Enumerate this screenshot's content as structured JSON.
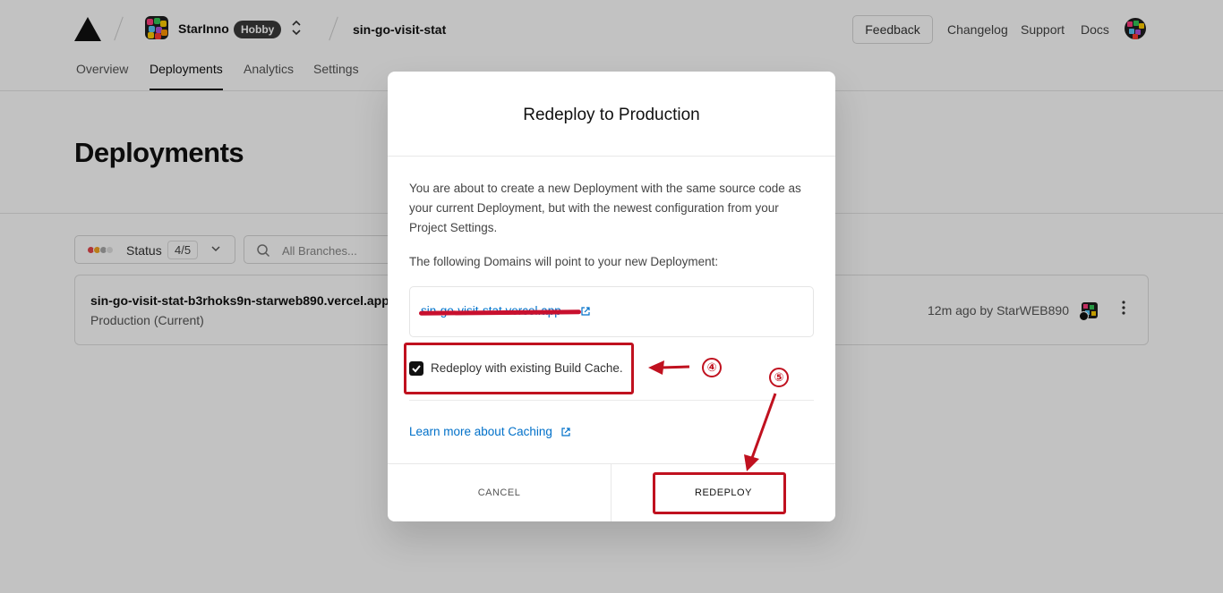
{
  "header": {
    "team_name": "StarInno",
    "plan_badge": "Hobby",
    "project_name": "sin-go-visit-stat",
    "feedback_label": "Feedback",
    "links": [
      "Changelog",
      "Support",
      "Docs"
    ]
  },
  "tabs": [
    {
      "label": "Overview",
      "active": false
    },
    {
      "label": "Deployments",
      "active": true
    },
    {
      "label": "Analytics",
      "active": false
    },
    {
      "label": "Settings",
      "active": false
    }
  ],
  "page_title": "Deployments",
  "filters": {
    "status_label": "Status",
    "status_count": "4/5",
    "branch_placeholder": "All Branches..."
  },
  "deployment": {
    "url": "sin-go-visit-stat-b3rhoks9n-starweb890.vercel.app",
    "environment": "Production (Current)",
    "meta": "12m ago by StarWEB890"
  },
  "modal": {
    "title": "Redeploy to Production",
    "description": "You are about to create a new Deployment with the same source code as your current Deployment, but with the newest configuration from your Project Settings.",
    "domains_label": "The following Domains will point to your new Deployment:",
    "domain": "sin-go-visit-stat.vercel.app",
    "cache_option_label": "Redeploy with existing Build Cache.",
    "cache_option_checked": true,
    "learn_more_label": "Learn more about Caching",
    "cancel_label": "CANCEL",
    "redeploy_label": "REDEPLOY"
  },
  "annotations": {
    "step_four": "④",
    "step_five": "⑤",
    "highlight_color": "#c0111f"
  },
  "colors": {
    "link": "#0070c9",
    "overlay": "rgba(0,0,0,0.24)"
  }
}
